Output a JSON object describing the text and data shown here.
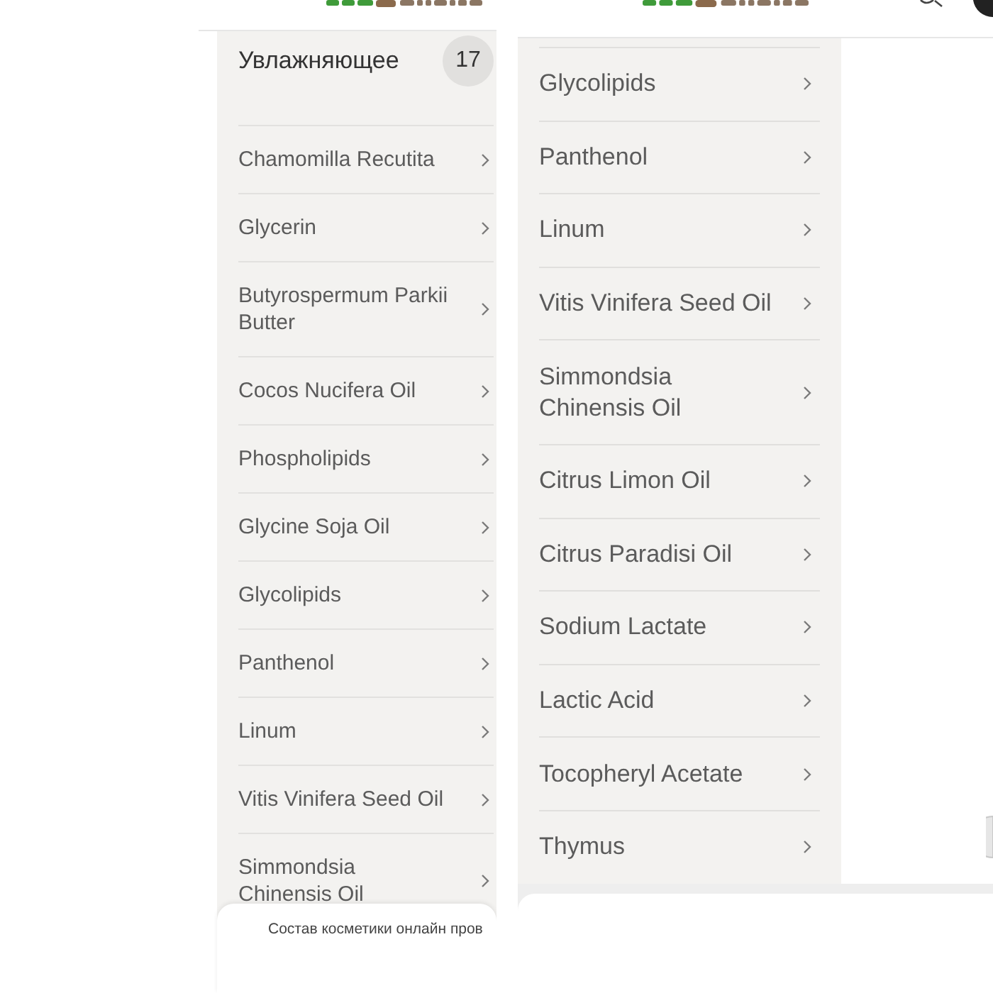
{
  "left_screen": {
    "category": {
      "title": "Увлажняющее",
      "count": "17"
    },
    "ingredients": [
      "Chamomilla Recutita",
      "Glycerin",
      "Butyrospermum Parkii Butter",
      "Cocos Nucifera Oil",
      "Phospholipids",
      "Glycine Soja Oil",
      "Glycolipids",
      "Panthenol",
      "Linum",
      "Vitis Vinifera Seed Oil",
      "Simmondsia Chinensis Oil"
    ],
    "footer_text": "Состав косметики онлайн пров"
  },
  "right_screen": {
    "ingredients": [
      "Glycolipids",
      "Panthenol",
      "Linum",
      "Vitis Vinifera Seed Oil",
      "Simmondsia Chinensis Oil",
      "Citrus Limon Oil",
      "Citrus Paradisi Oil",
      "Sodium Lactate",
      "Lactic Acid",
      "Tocopheryl Acetate",
      "Thymus"
    ]
  }
}
